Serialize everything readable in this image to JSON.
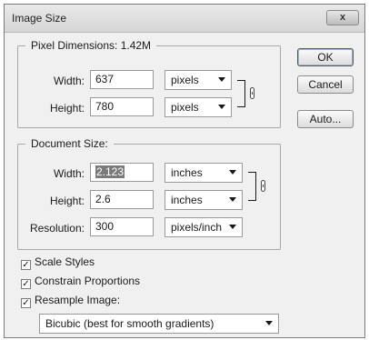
{
  "window": {
    "title": "Image Size",
    "close_label": "x"
  },
  "pixel_dimensions": {
    "legend": "Pixel Dimensions:  1.42M",
    "width_label": "Width:",
    "width_value": "637",
    "width_unit": "pixels",
    "height_label": "Height:",
    "height_value": "780",
    "height_unit": "pixels"
  },
  "document_size": {
    "legend": "Document Size:",
    "width_label": "Width:",
    "width_value": "2.123",
    "width_unit": "inches",
    "height_label": "Height:",
    "height_value": "2.6",
    "height_unit": "inches",
    "resolution_label": "Resolution:",
    "resolution_value": "300",
    "resolution_unit": "pixels/inch"
  },
  "buttons": {
    "ok": "OK",
    "cancel": "Cancel",
    "auto": "Auto..."
  },
  "options": {
    "scale_styles": {
      "label": "Scale Styles",
      "checked": true
    },
    "constrain_proportions": {
      "label": "Constrain Proportions",
      "checked": true
    },
    "resample_image": {
      "label": "Resample Image:",
      "checked": true
    },
    "resample_method": "Bicubic (best for smooth gradients)"
  },
  "icons": {
    "link": "chain-link-icon",
    "close": "close-icon",
    "checkmark": "✓"
  }
}
